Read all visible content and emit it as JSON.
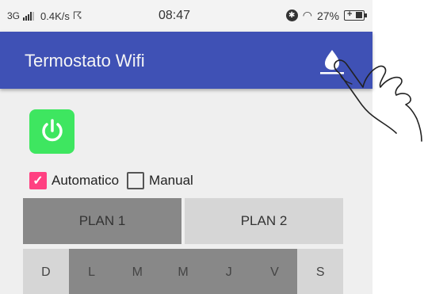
{
  "statusbar": {
    "network": "3G",
    "speed": "0.4K/s",
    "time": "08:47",
    "battery": "27%"
  },
  "appbar": {
    "title": "Termostato Wifi",
    "action_icon": "water-drop-icon",
    "accent": "#3f51b5"
  },
  "power": {
    "icon": "power-icon",
    "color": "#3ee660",
    "state": "on"
  },
  "modes": {
    "automatic_label": "Automatico",
    "automatic_checked": true,
    "manual_label": "Manual",
    "manual_checked": false,
    "check_color": "#ff4081"
  },
  "plans": {
    "items": [
      {
        "label": "PLAN 1",
        "selected": true
      },
      {
        "label": "PLAN 2",
        "selected": false
      }
    ]
  },
  "days": {
    "items": [
      {
        "label": "D",
        "active": false
      },
      {
        "label": "L",
        "active": true
      },
      {
        "label": "M",
        "active": true
      },
      {
        "label": "M",
        "active": true
      },
      {
        "label": "J",
        "active": true
      },
      {
        "label": "V",
        "active": true
      },
      {
        "label": "S",
        "active": false
      }
    ]
  },
  "overlay": {
    "icon": "hand-pointer-icon"
  }
}
